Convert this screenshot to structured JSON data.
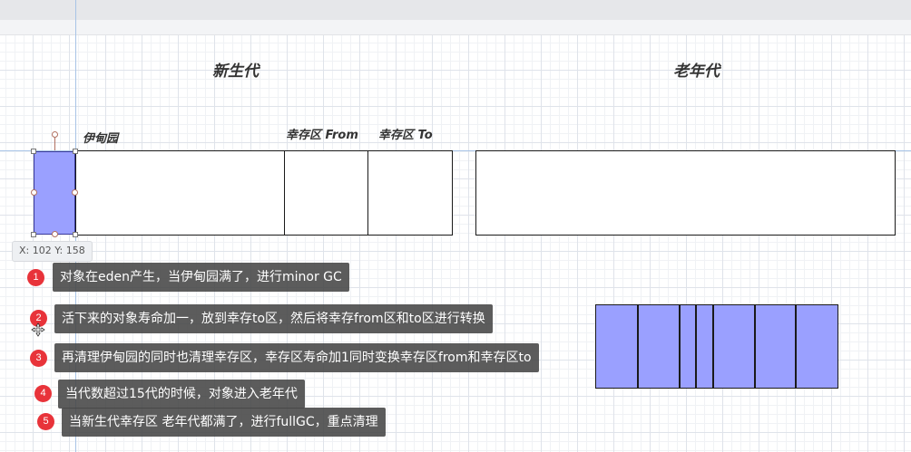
{
  "diagram": {
    "young_gen_title": "新生代",
    "old_gen_title": "老年代",
    "eden_label": "伊甸园",
    "survivor_from_label": "幸存区 From",
    "survivor_to_label": "幸存区 To"
  },
  "coord_readout": "X: 102  Y: 158",
  "steps": [
    {
      "num": "1",
      "text": "对象在eden产生，当伊甸园满了，进行minor GC"
    },
    {
      "num": "2",
      "text": "活下来的对象寿命加一，放到幸存to区，然后将幸存from区和to区进行转换"
    },
    {
      "num": "3",
      "text": "再清理伊甸园的同时也清理幸存区，幸存区寿命加1同时变换幸存区from和幸存区to"
    },
    {
      "num": "4",
      "text": "当代数超过15代的时候，对象进入老年代"
    },
    {
      "num": "5",
      "text": "当新生代幸存区 老年代都满了，进行fullGC，重点清理"
    }
  ],
  "colors": {
    "selected_fill": "#9aa0ff",
    "step_badge": "#e8333a",
    "step_bg": "#464646"
  }
}
